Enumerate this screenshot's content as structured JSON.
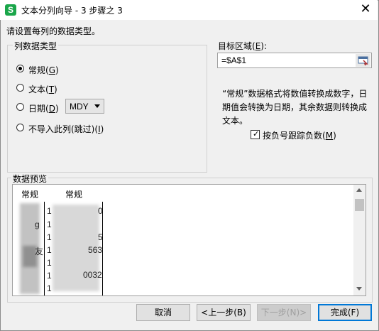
{
  "window": {
    "title": "文本分列向导 - 3 步骤之 3",
    "app_icon_letter": "S",
    "close_glyph": "✕"
  },
  "instruction": "请设置每列的数据类型。",
  "column_type_group": {
    "label": "列数据类型",
    "options": [
      {
        "text": "常规",
        "hotkey": "G",
        "checked": true
      },
      {
        "text": "文本",
        "hotkey": "T",
        "checked": false
      },
      {
        "text": "日期",
        "hotkey": "D",
        "checked": false
      },
      {
        "text": "不导入此列(跳过)",
        "hotkey": "I",
        "checked": false
      }
    ],
    "date_format": "MDY"
  },
  "target": {
    "label": "目标区域",
    "hotkey": "E",
    "value": "=$A$1"
  },
  "description": "“常规”数据格式将数值转换成数字，日期值会转换为日期，其余数据则转换成文本。",
  "negative_checkbox": {
    "label": "按负号跟踪负数",
    "hotkey": "M",
    "checked": true
  },
  "preview": {
    "label": "数据预览",
    "columns": [
      "常规",
      "常规"
    ],
    "visible_fragments": [
      {
        "row": 1,
        "col2": "0"
      },
      {
        "row": 2,
        "col1": "g"
      },
      {
        "row": 3,
        "col2": "5"
      },
      {
        "row": 4,
        "col1": "友",
        "col2": "563"
      },
      {
        "row": 6,
        "col2": "0032"
      }
    ]
  },
  "buttons": {
    "cancel": "取消",
    "back": "<上一步(B)",
    "next": "下一步(N)>",
    "finish": "完成(F)"
  }
}
